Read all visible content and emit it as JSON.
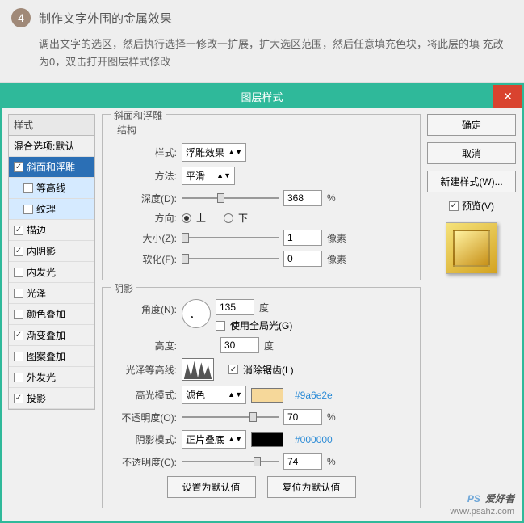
{
  "header": {
    "step_number": "4",
    "title": "制作文字外围的金属效果",
    "description": "调出文字的选区，然后执行选择一修改一扩展，扩大选区范围，然后任意填充色块，将此层的填 充改为0，双击打开图层样式修改"
  },
  "dialog": {
    "title": "图层样式",
    "close": "✕"
  },
  "sidebar": {
    "header": "样式",
    "blend": "混合选项:默认",
    "items": [
      {
        "label": "斜面和浮雕",
        "checked": true,
        "selected": true
      },
      {
        "label": "等高线",
        "checked": false,
        "sub": true
      },
      {
        "label": "纹理",
        "checked": false,
        "sub": true
      },
      {
        "label": "描边",
        "checked": true
      },
      {
        "label": "内阴影",
        "checked": true
      },
      {
        "label": "内发光",
        "checked": false
      },
      {
        "label": "光泽",
        "checked": false
      },
      {
        "label": "颜色叠加",
        "checked": false
      },
      {
        "label": "渐变叠加",
        "checked": true
      },
      {
        "label": "图案叠加",
        "checked": false
      },
      {
        "label": "外发光",
        "checked": false
      },
      {
        "label": "投影",
        "checked": true
      }
    ]
  },
  "bevel": {
    "group": "斜面和浮雕",
    "structure": "结构",
    "style_lbl": "样式:",
    "style_val": "浮雕效果",
    "method_lbl": "方法:",
    "method_val": "平滑",
    "depth_lbl": "深度(D):",
    "depth_val": "368",
    "pct": "%",
    "dir_lbl": "方向:",
    "dir_up": "上",
    "dir_down": "下",
    "size_lbl": "大小(Z):",
    "size_val": "1",
    "px": "像素",
    "soften_lbl": "软化(F):",
    "soften_val": "0"
  },
  "shade": {
    "group": "阴影",
    "angle_lbl": "角度(N):",
    "angle_val": "135",
    "deg": "度",
    "global": "使用全局光(G)",
    "alt_lbl": "高度:",
    "alt_val": "30",
    "gloss_lbl": "光泽等高线:",
    "aa": "消除锯齿(L)",
    "hl_mode_lbl": "高光模式:",
    "hl_mode_val": "滤色",
    "hl_color": "#f6d89a",
    "hl_hex": "#9a6e2e",
    "hl_op_lbl": "不透明度(O):",
    "hl_op_val": "70",
    "sh_mode_lbl": "阴影模式:",
    "sh_mode_val": "正片叠底",
    "sh_color": "#000000",
    "sh_hex": "#000000",
    "sh_op_lbl": "不透明度(C):",
    "sh_op_val": "74"
  },
  "footer": {
    "make_default": "设置为默认值",
    "reset_default": "复位为默认值"
  },
  "right": {
    "ok": "确定",
    "cancel": "取消",
    "new_style": "新建样式(W)...",
    "preview": "预览(V)"
  },
  "watermark": {
    "brand1": "PS",
    "brand2": "爱好者",
    "url": "www.psahz.com"
  }
}
